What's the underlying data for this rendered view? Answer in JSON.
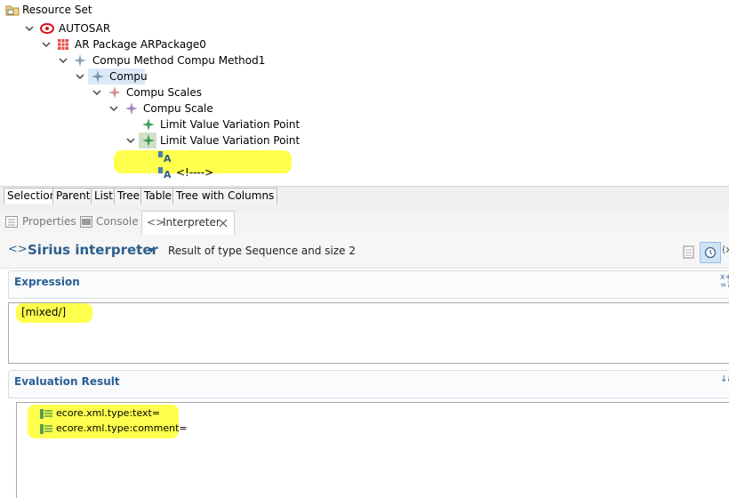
{
  "resource_set": {
    "title": "Resource Set"
  },
  "tree": [
    {
      "label": "AUTOSAR"
    },
    {
      "label": "AR Package ARPackage0"
    },
    {
      "label": "Compu Method Compu Method1"
    },
    {
      "label": "Compu"
    },
    {
      "label": "Compu Scales"
    },
    {
      "label": "Compu Scale"
    },
    {
      "label": "Limit Value Variation Point"
    },
    {
      "label": "Limit Value Variation Point"
    },
    {
      "label": ""
    },
    {
      "label": "<!---->"
    }
  ],
  "viewer_tabs": [
    "Selection",
    "Parent",
    "List",
    "Tree",
    "Table",
    "Tree with Columns"
  ],
  "view_tabs": {
    "properties": "Properties",
    "console": "Console",
    "interpreter": "Interpreter"
  },
  "interpreter": {
    "title": "Sirius interpreter",
    "result_info": "Result of type Sequence and size 2"
  },
  "expression": {
    "label": "Expression",
    "value": "[mixed/]"
  },
  "evaluation": {
    "label": "Evaluation Result",
    "items": [
      "ecore.xml.type:text=",
      "ecore.xml.type:comment="
    ]
  },
  "colors": {
    "highlight": "#ffff2e",
    "section_title": "#2b5f93",
    "interp_title": "#2d5f8c"
  }
}
